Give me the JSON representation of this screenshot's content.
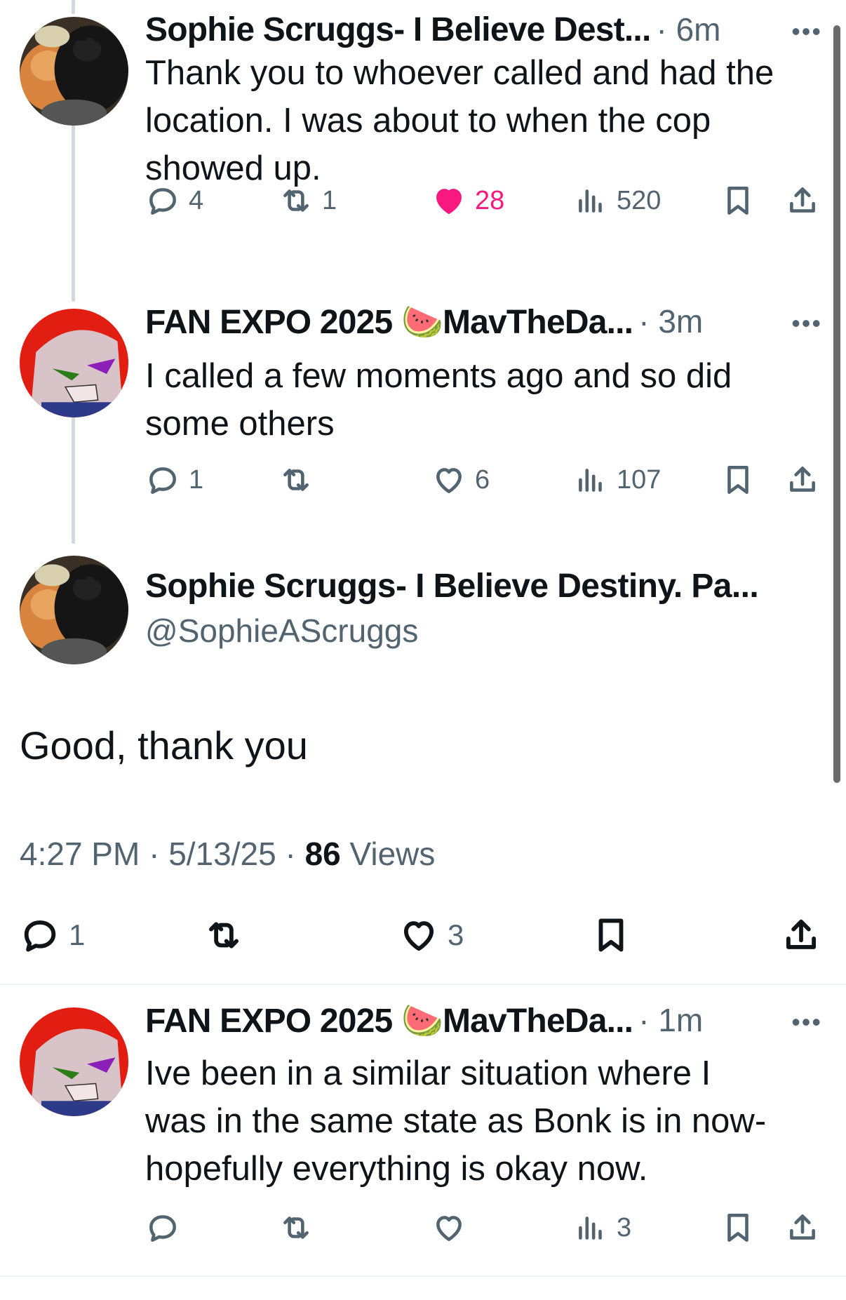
{
  "posts": [
    {
      "name": "Sophie Scruggs- I Believe Dest...",
      "time": "· 6m",
      "text": "Thank you to whoever called and had the location. I was about to when the cop showed up.",
      "replies": "4",
      "reposts": "1",
      "likes": "28",
      "views": "520"
    },
    {
      "name": "FAN EXPO 2025 🍉MavTheDa...",
      "time": "· 3m",
      "text": "I called a few moments ago and so did some others",
      "replies": "1",
      "reposts": "",
      "likes": "6",
      "views": "107"
    }
  ],
  "main": {
    "name": "Sophie Scruggs- I Believe Destiny. Pa...",
    "handle": "@SophieAScruggs",
    "text": "Good, thank you",
    "time": "4:27 PM",
    "date": "5/13/25",
    "views_count": "86",
    "views_label": "Views",
    "replies": "1",
    "reposts": "",
    "likes": "3"
  },
  "reply": {
    "name": "FAN EXPO 2025 🍉MavTheDa...",
    "time": "· 1m",
    "text": "Ive been in a similar situation where I was in the same state as Bonk is in now- hopefully everything is okay now.",
    "replies": "",
    "reposts": "",
    "likes": "",
    "views": "3"
  },
  "more_label": "•••",
  "separator": "·",
  "colors": {
    "like": "#f91880",
    "muted": "#536471",
    "text": "#0f1419"
  }
}
